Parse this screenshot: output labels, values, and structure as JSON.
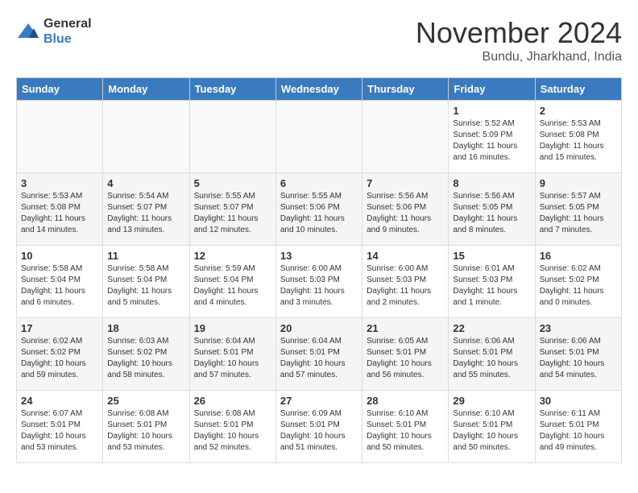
{
  "header": {
    "logo_line1": "General",
    "logo_line2": "Blue",
    "month": "November 2024",
    "location": "Bundu, Jharkhand, India"
  },
  "weekdays": [
    "Sunday",
    "Monday",
    "Tuesday",
    "Wednesday",
    "Thursday",
    "Friday",
    "Saturday"
  ],
  "weeks": [
    [
      {
        "day": "",
        "text": ""
      },
      {
        "day": "",
        "text": ""
      },
      {
        "day": "",
        "text": ""
      },
      {
        "day": "",
        "text": ""
      },
      {
        "day": "",
        "text": ""
      },
      {
        "day": "1",
        "text": "Sunrise: 5:52 AM\nSunset: 5:09 PM\nDaylight: 11 hours and 16 minutes."
      },
      {
        "day": "2",
        "text": "Sunrise: 5:53 AM\nSunset: 5:08 PM\nDaylight: 11 hours and 15 minutes."
      }
    ],
    [
      {
        "day": "3",
        "text": "Sunrise: 5:53 AM\nSunset: 5:08 PM\nDaylight: 11 hours and 14 minutes."
      },
      {
        "day": "4",
        "text": "Sunrise: 5:54 AM\nSunset: 5:07 PM\nDaylight: 11 hours and 13 minutes."
      },
      {
        "day": "5",
        "text": "Sunrise: 5:55 AM\nSunset: 5:07 PM\nDaylight: 11 hours and 12 minutes."
      },
      {
        "day": "6",
        "text": "Sunrise: 5:55 AM\nSunset: 5:06 PM\nDaylight: 11 hours and 10 minutes."
      },
      {
        "day": "7",
        "text": "Sunrise: 5:56 AM\nSunset: 5:06 PM\nDaylight: 11 hours and 9 minutes."
      },
      {
        "day": "8",
        "text": "Sunrise: 5:56 AM\nSunset: 5:05 PM\nDaylight: 11 hours and 8 minutes."
      },
      {
        "day": "9",
        "text": "Sunrise: 5:57 AM\nSunset: 5:05 PM\nDaylight: 11 hours and 7 minutes."
      }
    ],
    [
      {
        "day": "10",
        "text": "Sunrise: 5:58 AM\nSunset: 5:04 PM\nDaylight: 11 hours and 6 minutes."
      },
      {
        "day": "11",
        "text": "Sunrise: 5:58 AM\nSunset: 5:04 PM\nDaylight: 11 hours and 5 minutes."
      },
      {
        "day": "12",
        "text": "Sunrise: 5:59 AM\nSunset: 5:04 PM\nDaylight: 11 hours and 4 minutes."
      },
      {
        "day": "13",
        "text": "Sunrise: 6:00 AM\nSunset: 5:03 PM\nDaylight: 11 hours and 3 minutes."
      },
      {
        "day": "14",
        "text": "Sunrise: 6:00 AM\nSunset: 5:03 PM\nDaylight: 11 hours and 2 minutes."
      },
      {
        "day": "15",
        "text": "Sunrise: 6:01 AM\nSunset: 5:03 PM\nDaylight: 11 hours and 1 minute."
      },
      {
        "day": "16",
        "text": "Sunrise: 6:02 AM\nSunset: 5:02 PM\nDaylight: 11 hours and 0 minutes."
      }
    ],
    [
      {
        "day": "17",
        "text": "Sunrise: 6:02 AM\nSunset: 5:02 PM\nDaylight: 10 hours and 59 minutes."
      },
      {
        "day": "18",
        "text": "Sunrise: 6:03 AM\nSunset: 5:02 PM\nDaylight: 10 hours and 58 minutes."
      },
      {
        "day": "19",
        "text": "Sunrise: 6:04 AM\nSunset: 5:01 PM\nDaylight: 10 hours and 57 minutes."
      },
      {
        "day": "20",
        "text": "Sunrise: 6:04 AM\nSunset: 5:01 PM\nDaylight: 10 hours and 57 minutes."
      },
      {
        "day": "21",
        "text": "Sunrise: 6:05 AM\nSunset: 5:01 PM\nDaylight: 10 hours and 56 minutes."
      },
      {
        "day": "22",
        "text": "Sunrise: 6:06 AM\nSunset: 5:01 PM\nDaylight: 10 hours and 55 minutes."
      },
      {
        "day": "23",
        "text": "Sunrise: 6:06 AM\nSunset: 5:01 PM\nDaylight: 10 hours and 54 minutes."
      }
    ],
    [
      {
        "day": "24",
        "text": "Sunrise: 6:07 AM\nSunset: 5:01 PM\nDaylight: 10 hours and 53 minutes."
      },
      {
        "day": "25",
        "text": "Sunrise: 6:08 AM\nSunset: 5:01 PM\nDaylight: 10 hours and 53 minutes."
      },
      {
        "day": "26",
        "text": "Sunrise: 6:08 AM\nSunset: 5:01 PM\nDaylight: 10 hours and 52 minutes."
      },
      {
        "day": "27",
        "text": "Sunrise: 6:09 AM\nSunset: 5:01 PM\nDaylight: 10 hours and 51 minutes."
      },
      {
        "day": "28",
        "text": "Sunrise: 6:10 AM\nSunset: 5:01 PM\nDaylight: 10 hours and 50 minutes."
      },
      {
        "day": "29",
        "text": "Sunrise: 6:10 AM\nSunset: 5:01 PM\nDaylight: 10 hours and 50 minutes."
      },
      {
        "day": "30",
        "text": "Sunrise: 6:11 AM\nSunset: 5:01 PM\nDaylight: 10 hours and 49 minutes."
      }
    ]
  ]
}
